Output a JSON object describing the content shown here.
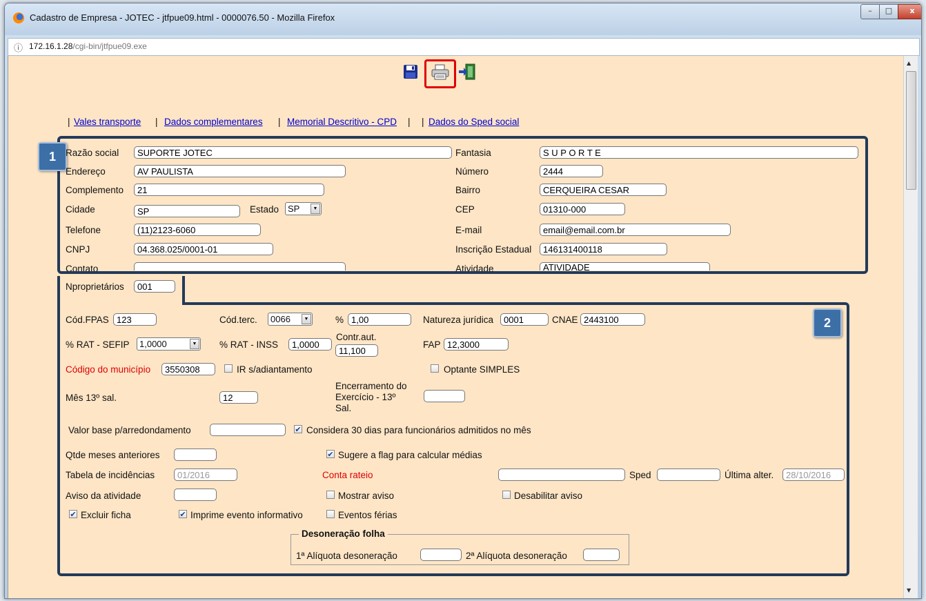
{
  "window": {
    "title": "Cadastro de Empresa - JOTEC - jtfpue09.html - 0000076.50 - Mozilla Firefox",
    "controls": [
      "–",
      "□",
      "x"
    ]
  },
  "urlbar": {
    "host": "172.16.1.28",
    "path": "/cgi-bin/jtfpue09.exe"
  },
  "toolbar": {
    "save_icon": "floppy-save-icon",
    "print_icon": "printer-icon",
    "exit_icon": "exit-door-icon",
    "highlight_color": "#e00000"
  },
  "nav": {
    "sep": "|",
    "links": [
      "Vales transporte",
      "Dados complementares",
      "Memorial Descritivo - CPD",
      "Dados do Sped social"
    ]
  },
  "badges": {
    "one": "1",
    "two": "2",
    "color": "#3d6fa7"
  },
  "section1": {
    "razao_label": "Razão social",
    "razao": "SUPORTE  JOTEC",
    "fantasia_label": "Fantasia",
    "fantasia": "S U P O R T E",
    "endereco_label": "Endereço",
    "endereco": "AV PAULISTA",
    "numero_label": "Número",
    "numero": "2444",
    "complemento_label": "Complemento",
    "complemento": "21",
    "bairro_label": "Bairro",
    "bairro": "CERQUEIRA CESAR",
    "cidade_label": "Cidade",
    "cidade": "SP",
    "estado_label": "Estado",
    "estado": "SP",
    "cep_label": "CEP",
    "cep": "01310-000",
    "telefone_label": "Telefone",
    "telefone": "(11)2123-6060",
    "email_label": "E-mail",
    "email": "email@email.com.br",
    "cnpj_label": "CNPJ",
    "cnpj": "04.368.025/0001-01",
    "ie_label": "Inscrição Estadual",
    "ie": "146131400118",
    "contato_label": "Contato",
    "contato": "",
    "atividade_label": "Atividade",
    "atividade": "ATIVIDADE"
  },
  "nproprietarios_label": "Nproprietários",
  "nproprietarios": "001",
  "section2": {
    "fpas_label": "Cód.FPAS",
    "fpas": "123",
    "codterc_label": "Cód.terc.",
    "codterc": "0066",
    "pct_label": "%",
    "pct": "1,00",
    "natureza_label": "Natureza jurídica",
    "natureza": "0001",
    "cnae_label": "CNAE",
    "cnae": "2443100",
    "rat_sefip_label": "% RAT - SEFIP",
    "rat_sefip": "1,0000",
    "rat_inss_label": "% RAT - INSS",
    "rat_inss": "1,0000",
    "contraut_label": "Contr.aut.",
    "contraut": "11,100",
    "fap_label": "FAP",
    "fap": "12,3000",
    "codmun_label": "Código do município",
    "codmun": "3550308",
    "ir_label": "IR s/adiantamento",
    "ir_checked": false,
    "simples_label": "Optante SIMPLES",
    "simples_checked": false,
    "mes13_label": "Mês 13º sal.",
    "mes13": "12",
    "encerr_label_1": "Encerramento do",
    "encerr_label_2": "Exercício - 13º",
    "encerr_label_3": "Sal.",
    "encerr": "",
    "valorbase_label": "Valor base p/arredondamento",
    "valorbase": "",
    "considera_label": "Considera 30 dias para funcionários admitidos no mês",
    "considera_checked": true,
    "qtde_label": "Qtde meses anteriores",
    "qtde": "",
    "sugere_label": "Sugere a flag para calcular médias",
    "sugere_checked": true,
    "tabela_label": "Tabela de incidências",
    "tabela": "01/2016",
    "conta_label": "Conta rateio",
    "conta": "",
    "sped_label": "Sped",
    "sped": "",
    "ultima_label": "Última alter.",
    "ultima": "28/10/2016",
    "aviso_label": "Aviso da atividade",
    "aviso": "",
    "mostrar_label": "Mostrar aviso",
    "mostrar_checked": false,
    "desabilitar_label": "Desabilitar aviso",
    "desabilitar_checked": false,
    "excluir_label": "Excluir ficha",
    "excluir_checked": true,
    "imprime_label": "Imprime evento informativo",
    "imprime_checked": true,
    "ferias_label": "Eventos férias",
    "ferias_checked": false,
    "deson_title": "Desoneração folha",
    "aliq1_label": "1ª Alíquota desoneração",
    "aliq1": "",
    "aliq2_label": "2ª Alíquota desoneração",
    "aliq2": ""
  },
  "check_mark": "✔"
}
